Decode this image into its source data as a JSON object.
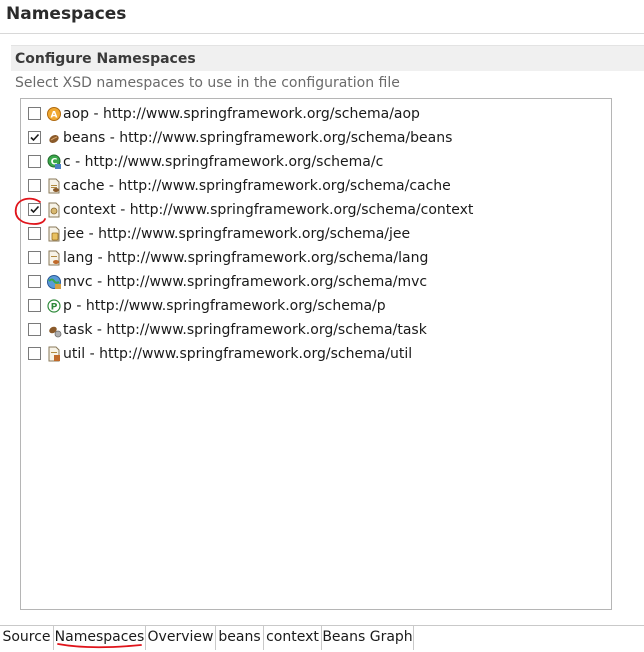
{
  "header": {
    "title": "Namespaces"
  },
  "section": {
    "title": "Configure Namespaces",
    "description": "Select XSD namespaces to use in the configuration file"
  },
  "namespaces": [
    {
      "label": "aop - http://www.springframework.org/schema/aop",
      "checked": false,
      "icon": "aop-icon"
    },
    {
      "label": "beans - http://www.springframework.org/schema/beans",
      "checked": true,
      "icon": "beans-icon"
    },
    {
      "label": "c - http://www.springframework.org/schema/c",
      "checked": false,
      "icon": "c-namespace-icon"
    },
    {
      "label": "cache - http://www.springframework.org/schema/cache",
      "checked": false,
      "icon": "cache-icon"
    },
    {
      "label": "context - http://www.springframework.org/schema/context",
      "checked": true,
      "icon": "context-icon"
    },
    {
      "label": "jee - http://www.springframework.org/schema/jee",
      "checked": false,
      "icon": "jee-icon"
    },
    {
      "label": "lang - http://www.springframework.org/schema/lang",
      "checked": false,
      "icon": "lang-icon"
    },
    {
      "label": "mvc - http://www.springframework.org/schema/mvc",
      "checked": false,
      "icon": "mvc-icon"
    },
    {
      "label": "p - http://www.springframework.org/schema/p",
      "checked": false,
      "icon": "p-namespace-icon"
    },
    {
      "label": "task - http://www.springframework.org/schema/task",
      "checked": false,
      "icon": "task-icon"
    },
    {
      "label": "util - http://www.springframework.org/schema/util",
      "checked": false,
      "icon": "util-icon"
    }
  ],
  "tabs": [
    {
      "label": "Source",
      "active": false
    },
    {
      "label": "Namespaces",
      "active": true
    },
    {
      "label": "Overview",
      "active": false
    },
    {
      "label": "beans",
      "active": false
    },
    {
      "label": "context",
      "active": false
    },
    {
      "label": "Beans Graph",
      "active": false
    }
  ],
  "colors": {
    "annotation": "#e0141b",
    "border": "#b5b5b5",
    "section_bar": "#f0f0f0"
  }
}
